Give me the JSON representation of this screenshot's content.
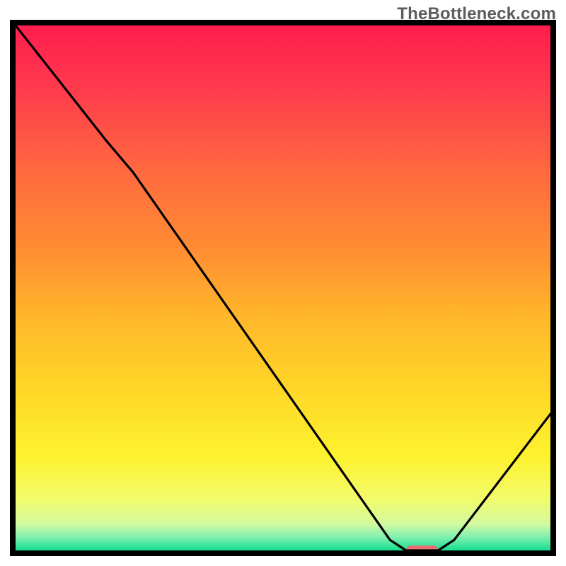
{
  "watermark": "TheBottleneck.com",
  "colors": {
    "frame": "#000000",
    "curve": "#000000",
    "marker": "#e96f75",
    "gradient_stops": [
      {
        "offset": 0.0,
        "color": "#ff1d4d"
      },
      {
        "offset": 0.12,
        "color": "#ff3a4d"
      },
      {
        "offset": 0.28,
        "color": "#ff6a3f"
      },
      {
        "offset": 0.42,
        "color": "#ff8b33"
      },
      {
        "offset": 0.56,
        "color": "#ffb82a"
      },
      {
        "offset": 0.7,
        "color": "#ffd827"
      },
      {
        "offset": 0.82,
        "color": "#fdf22e"
      },
      {
        "offset": 0.9,
        "color": "#f4fb6a"
      },
      {
        "offset": 0.95,
        "color": "#d2fa9f"
      },
      {
        "offset": 0.975,
        "color": "#7ef0b0"
      },
      {
        "offset": 1.0,
        "color": "#16de8d"
      }
    ]
  },
  "chart_data": {
    "type": "line",
    "title": "",
    "xlabel": "",
    "ylabel": "",
    "xlim": [
      0,
      100
    ],
    "ylim": [
      0,
      100
    ],
    "x": [
      0,
      17,
      22,
      70,
      73,
      79,
      82,
      100
    ],
    "values": [
      100,
      78,
      72,
      2,
      0,
      0,
      2,
      26
    ],
    "marker": {
      "x_start": 73,
      "x_end": 79,
      "y": 0
    },
    "notes": "Single black curve on red→green vertical gradient. Curve starts top-left, slight kink near x≈18, descends nearly linearly to a flat minimum around x≈73–79 (pink marker), then rises toward bottom-right. Y encodes some bottleneck metric (100=bad red, 0=good green); axes are unlabeled in the image."
  }
}
